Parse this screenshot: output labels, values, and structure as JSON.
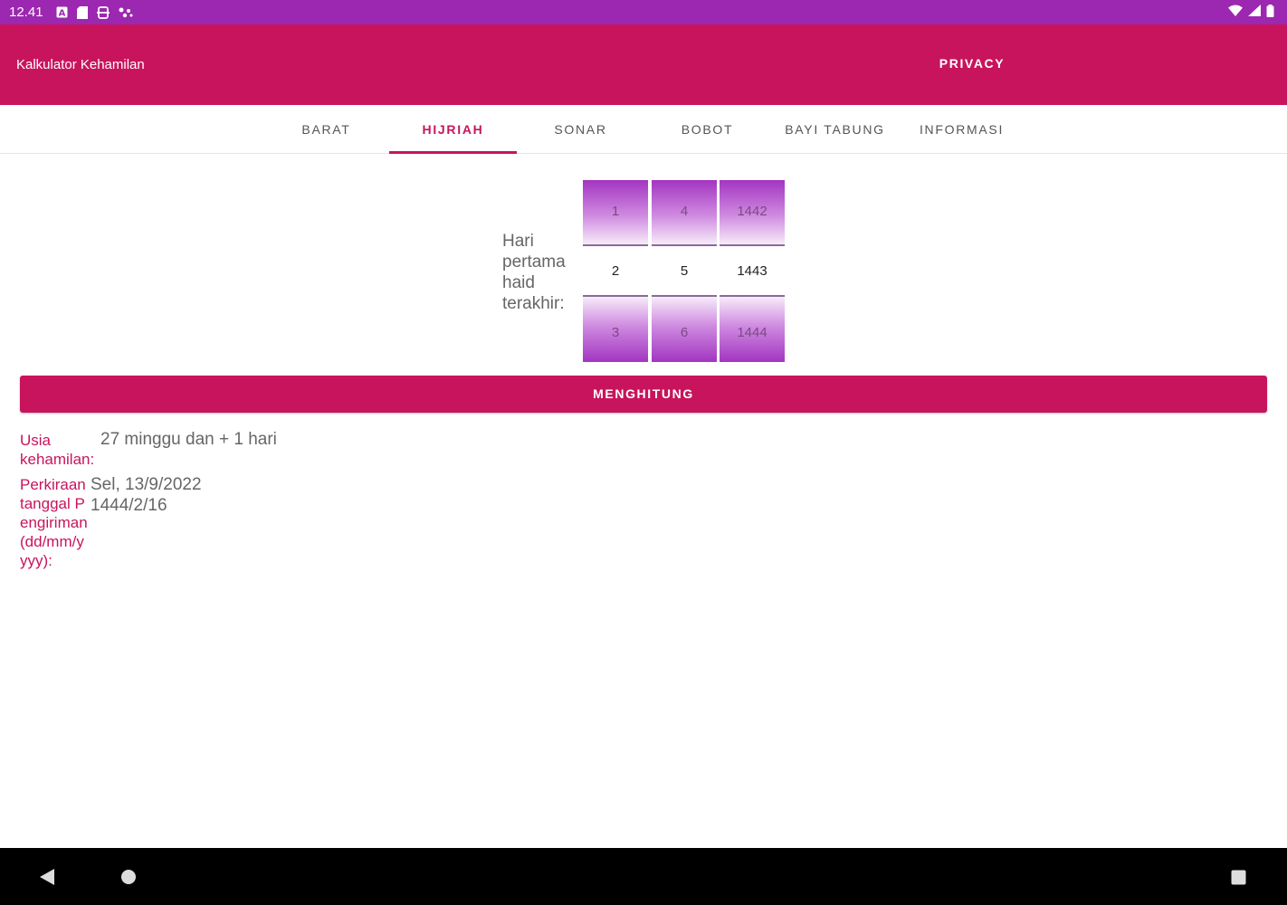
{
  "status_bar": {
    "time": "12.41",
    "left_icons": [
      "a-icon",
      "sd-card-icon",
      "sync-icon",
      "dots-icon"
    ],
    "right_icons": [
      "wifi-icon",
      "signal-icon",
      "battery-icon"
    ]
  },
  "app_bar": {
    "title": "Kalkulator Kehamilan",
    "privacy": "PRIVACY",
    "color": "#c8145d"
  },
  "tabs": [
    {
      "label": "BARAT",
      "active": false
    },
    {
      "label": "HIJRIAH",
      "active": true
    },
    {
      "label": "SONAR",
      "active": false
    },
    {
      "label": "BOBOT",
      "active": false
    },
    {
      "label": "BAYI TABUNG",
      "active": false
    },
    {
      "label": "INFORMASI",
      "active": false
    }
  ],
  "form": {
    "label": "Hari pertama haid terakhir:",
    "pickers": [
      {
        "above": "1",
        "selected": "2",
        "below": "3"
      },
      {
        "above": "4",
        "selected": "5",
        "below": "6"
      },
      {
        "above": "1442",
        "selected": "1443",
        "below": "1444"
      }
    ]
  },
  "button": {
    "label": "MENGHITUNG"
  },
  "results": {
    "age_label": "Usia kehamilan:",
    "age_value": "27 minggu dan + 1 hari",
    "due_label": "Perkiraan tanggal Pengiriman (dd/mm/yyyy):",
    "due_value_line1": "Sel, 13/9/2022",
    "due_value_line2": "1444/2/16"
  },
  "nav_bar": {
    "icons": [
      "back-icon",
      "home-icon",
      "recents-icon"
    ]
  }
}
